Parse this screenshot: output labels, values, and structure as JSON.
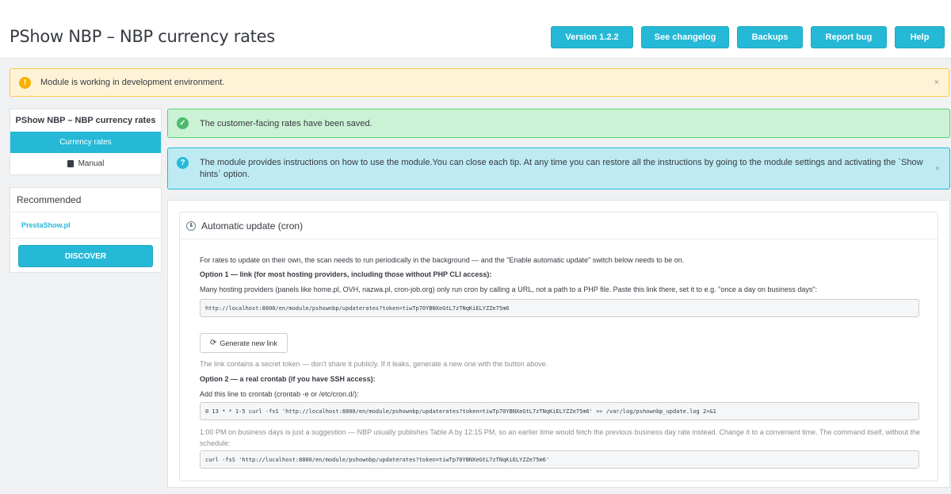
{
  "header": {
    "title": "PShow NBP – NBP currency rates",
    "buttons": [
      "Version 1.2.2",
      "See changelog",
      "Backups",
      "Report bug",
      "Help"
    ]
  },
  "alerts": {
    "warning": "Module is working in development environment.",
    "success": "The customer-facing rates have been saved.",
    "info": "The module provides instructions on how to use the module.You can close each tip. At any time you can restore all the instructions by going to the module settings and activating the `Show hints` option.",
    "close": "×"
  },
  "sidebar": {
    "title": "PShow NBP – NBP currency rates",
    "items": [
      {
        "label": "Currency rates",
        "active": true
      },
      {
        "label": "Manual",
        "icon": "book-icon"
      }
    ],
    "recommended": {
      "title": "Recommended",
      "link": "PrestaShow.pl",
      "button": "DISCOVER"
    }
  },
  "panel": {
    "title": "Automatic update (cron)",
    "intro": "For rates to update on their own, the scan needs to run periodically in the background — and the \"Enable automatic update\" switch below needs to be on.",
    "option1_title": "Option 1 — link (for most hosting providers, including those without PHP CLI access):",
    "option1_desc": "Many hosting providers (panels like home.pl, OVH, nazwa.pl, cron-job.org) only run cron by calling a URL, not a path to a PHP file. Paste this link there, set it to e.g. \"once a day on business days\":",
    "option1_url": "http://localhost:8800/en/module/pshownbp/updaterates?token=tiwTp70YBNXeGtL7zTNqKiELYZZe75m6",
    "generate_button": "Generate new link",
    "token_note": "The link contains a secret token — don't share it publicly. If it leaks, generate a new one with the button above.",
    "option2_title": "Option 2 — a real crontab (if you have SSH access):",
    "option2_desc": "Add this line to crontab (crontab -e or /etc/cron.d/):",
    "crontab_line": "0 13 * * 1-5 curl -fsS 'http://localhost:8800/en/module/pshownbp/updaterates?token=tiwTp70YBNXeGtL7zTNqKiELYZZe75m6' >> /var/log/pshownbp_update.log 2>&1",
    "schedule_note": "1:00 PM on business days is just a suggestion — NBP usually publishes Table A by 12:15 PM, so an earlier time would fetch the previous business day rate instead. Change it to a convenient time. The command itself, without the schedule:",
    "command": "curl -fsS 'http://localhost:8800/en/module/pshownbp/updaterates?token=tiwTp70YBNXeGtL7zTNqKiELYZZe75m6'"
  },
  "colors": {
    "accent": "#25b9d7",
    "warning": "#fab000",
    "success": "#4cbb6c"
  }
}
